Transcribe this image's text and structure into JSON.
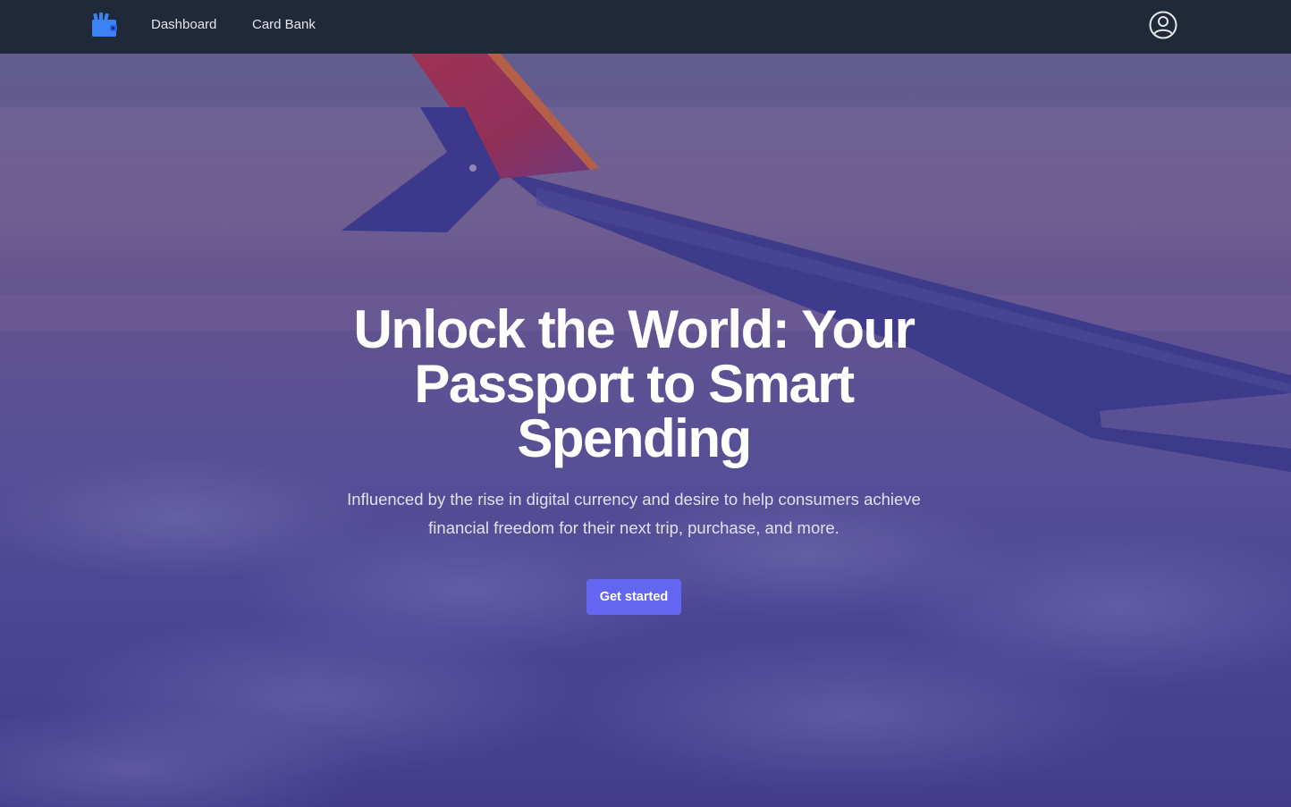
{
  "nav": {
    "logo_icon": "wallet-icon",
    "links": [
      {
        "label": "Dashboard"
      },
      {
        "label": "Card Bank"
      }
    ],
    "user_icon": "user-circle-icon"
  },
  "hero": {
    "background": "airplane-wing-above-clouds",
    "title": "Unlock the World: Your Passport to Smart Spending",
    "subtitle": "Influenced by the rise in digital currency and desire to help consumers achieve financial freedom for their next trip, purchase, and more.",
    "cta_label": "Get started"
  },
  "colors": {
    "nav_bg": "#1f2937",
    "accent": "#6366f1",
    "logo": "#3b82f6"
  }
}
